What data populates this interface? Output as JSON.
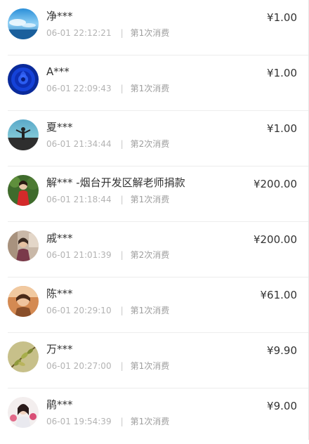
{
  "donations": [
    {
      "name": "净***",
      "time": "06-01 22:12:21",
      "separator": "|",
      "count": "第1次消费",
      "amount": "¥1.00",
      "avatar": "sky-sea-icon"
    },
    {
      "name": "A***",
      "time": "06-01 22:09:43",
      "separator": "|",
      "count": "第1次消费",
      "amount": "¥1.00",
      "avatar": "blue-rose-icon"
    },
    {
      "name": "夏***",
      "time": "06-01 21:34:44",
      "separator": "|",
      "count": "第2次消费",
      "amount": "¥1.00",
      "avatar": "beach-person-icon"
    },
    {
      "name": "解*** -烟台开发区解老师捐款",
      "time": "06-01 21:18:44",
      "separator": "|",
      "count": "第1次消费",
      "amount": "¥200.00",
      "avatar": "woman-red-dress-icon"
    },
    {
      "name": "戚***",
      "time": "06-01 21:01:39",
      "separator": "|",
      "count": "第2次消费",
      "amount": "¥200.00",
      "avatar": "person-indoor-icon"
    },
    {
      "name": "陈***",
      "time": "06-01 20:29:10",
      "separator": "|",
      "count": "第1次消费",
      "amount": "¥61.00",
      "avatar": "child-portrait-icon"
    },
    {
      "name": "万***",
      "time": "06-01 20:27:00",
      "separator": "|",
      "count": "第1次消费",
      "amount": "¥9.90",
      "avatar": "plant-branch-icon"
    },
    {
      "name": "鹃***",
      "time": "06-01 19:54:39",
      "separator": "|",
      "count": "第1次消费",
      "amount": "¥9.00",
      "avatar": "woman-flowers-icon"
    }
  ]
}
